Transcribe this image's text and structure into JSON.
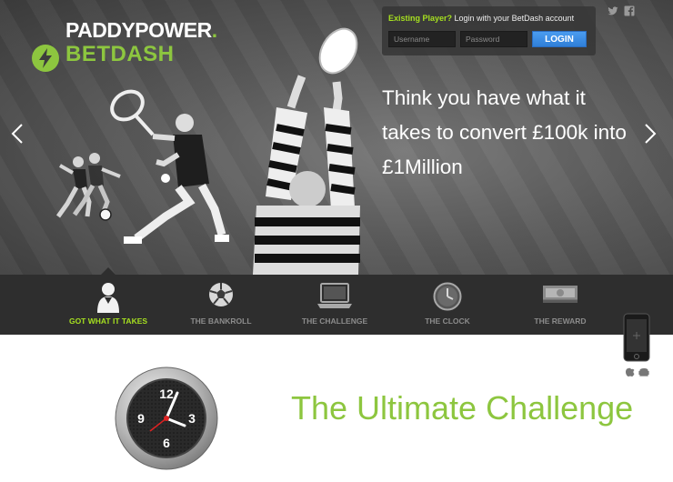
{
  "logo": {
    "line1": "PADDYPOWER",
    "line1_dot": ".",
    "line2": "BETDASH"
  },
  "login": {
    "prompt_highlight": "Existing Player?",
    "prompt_rest": " Login with your BetDash account",
    "username_placeholder": "Username",
    "password_placeholder": "Password",
    "button_label": "LOGIN"
  },
  "social": {
    "twitter": "twitter-icon",
    "facebook": "facebook-icon"
  },
  "hero": {
    "headline": "Think you have what it takes to convert £100k into £1Million"
  },
  "nav": {
    "items": [
      {
        "label": "GOT WHAT IT TAKES",
        "icon": "person-icon",
        "active": true
      },
      {
        "label": "THE BANKROLL",
        "icon": "football-icon",
        "active": false
      },
      {
        "label": "THE CHALLENGE",
        "icon": "laptop-icon",
        "active": false
      },
      {
        "label": "THE CLOCK",
        "icon": "clock-icon",
        "active": false
      },
      {
        "label": "THE REWARD",
        "icon": "cash-icon",
        "active": false
      }
    ]
  },
  "section": {
    "title": "The Ultimate Challenge"
  },
  "clock_face": {
    "n12": "12",
    "n3": "3",
    "n6": "6",
    "n9": "9"
  },
  "colors": {
    "brand_green": "#8dc63f",
    "active_green": "#a6e020",
    "login_blue": "#3a8be4",
    "nav_bg": "#2e2e2e"
  }
}
